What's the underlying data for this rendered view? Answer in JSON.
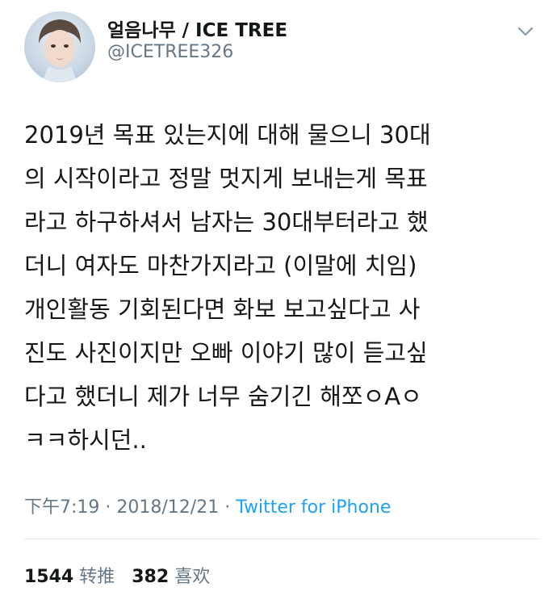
{
  "user": {
    "display_name": "얼음나무 / ICE TREE",
    "handle": "@ICETREE326",
    "avatar_icon": "profile-photo"
  },
  "tweet": {
    "text": "2019년 목표 있는지에 대해 물으니 30대\n의 시작이라고 정말 멋지게 보내는게 목표\n라고 하구하셔서 남자는 30대부터라고 했\n더니 여자도 마찬가지라고 (이말에 치임)\n개인활동 기회된다면 화보 보고싶다고 사\n진도 사진이지만 오빠 이야기 많이 듣고싶\n다고 했더니 제가 너무 숨기긴 해쪼ㅇAㅇ\nㅋㅋ하시던..",
    "time": "下午7:19",
    "separator": " · ",
    "date": "2018/12/21",
    "source": "Twitter for iPhone"
  },
  "stats": {
    "retweets_count": "1544",
    "retweets_label": "转推",
    "likes_count": "382",
    "likes_label": "喜欢"
  },
  "colors": {
    "text": "#14171a",
    "secondary": "#657786",
    "link": "#1da1f2",
    "divider": "#e1e8ed"
  }
}
